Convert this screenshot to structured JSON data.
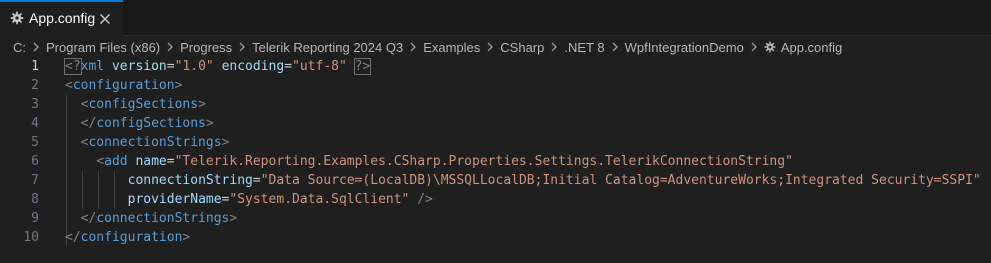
{
  "tab": {
    "label": "App.config",
    "icon": "gear-icon",
    "close_icon": "close-icon"
  },
  "breadcrumb": [
    "C:",
    "Program Files (x86)",
    "Progress",
    "Telerik Reporting 2024 Q3",
    "Examples",
    "CSharp",
    ".NET 8",
    "WpfIntegrationDemo",
    "App.config"
  ],
  "line_numbers": [
    "1",
    "2",
    "3",
    "4",
    "5",
    "6",
    "7",
    "8",
    "9",
    "10"
  ],
  "active_line": "1",
  "code": {
    "l1": {
      "open": "<?",
      "name": "xml",
      "a1": "version",
      "eq": "=",
      "v1": "\"1.0\"",
      "a2": "encoding",
      "v2": "\"utf-8\"",
      "close": "?>"
    },
    "l2": {
      "lt": "<",
      "name": "configuration",
      "gt": ">"
    },
    "l3": {
      "lt": "<",
      "name": "configSections",
      "gt": ">"
    },
    "l4": {
      "lt": "</",
      "name": "configSections",
      "gt": ">"
    },
    "l5": {
      "lt": "<",
      "name": "connectionStrings",
      "gt": ">"
    },
    "l6": {
      "lt": "<",
      "name": "add",
      "attr": "name",
      "eq": "=",
      "val": "\"Telerik.Reporting.Examples.CSharp.Properties.Settings.TelerikConnectionString\""
    },
    "l7": {
      "attr": "connectionString",
      "eq": "=",
      "val": "\"Data Source=(LocalDB)\\MSSQLLocalDB;Initial Catalog=AdventureWorks;Integrated Security=SSPI\""
    },
    "l8": {
      "attr": "providerName",
      "eq": "=",
      "val": "\"System.Data.SqlClient\"",
      "close": "/>"
    },
    "l9": {
      "lt": "</",
      "name": "connectionStrings",
      "gt": ">"
    },
    "l10": {
      "lt": "</",
      "name": "configuration",
      "gt": ">"
    }
  },
  "colors": {
    "tag": "#569cd6",
    "attr": "#9cdcfe",
    "value": "#ce9178",
    "bracket": "#808080",
    "background": "#1f1f1f",
    "accent": "#0078d4"
  }
}
